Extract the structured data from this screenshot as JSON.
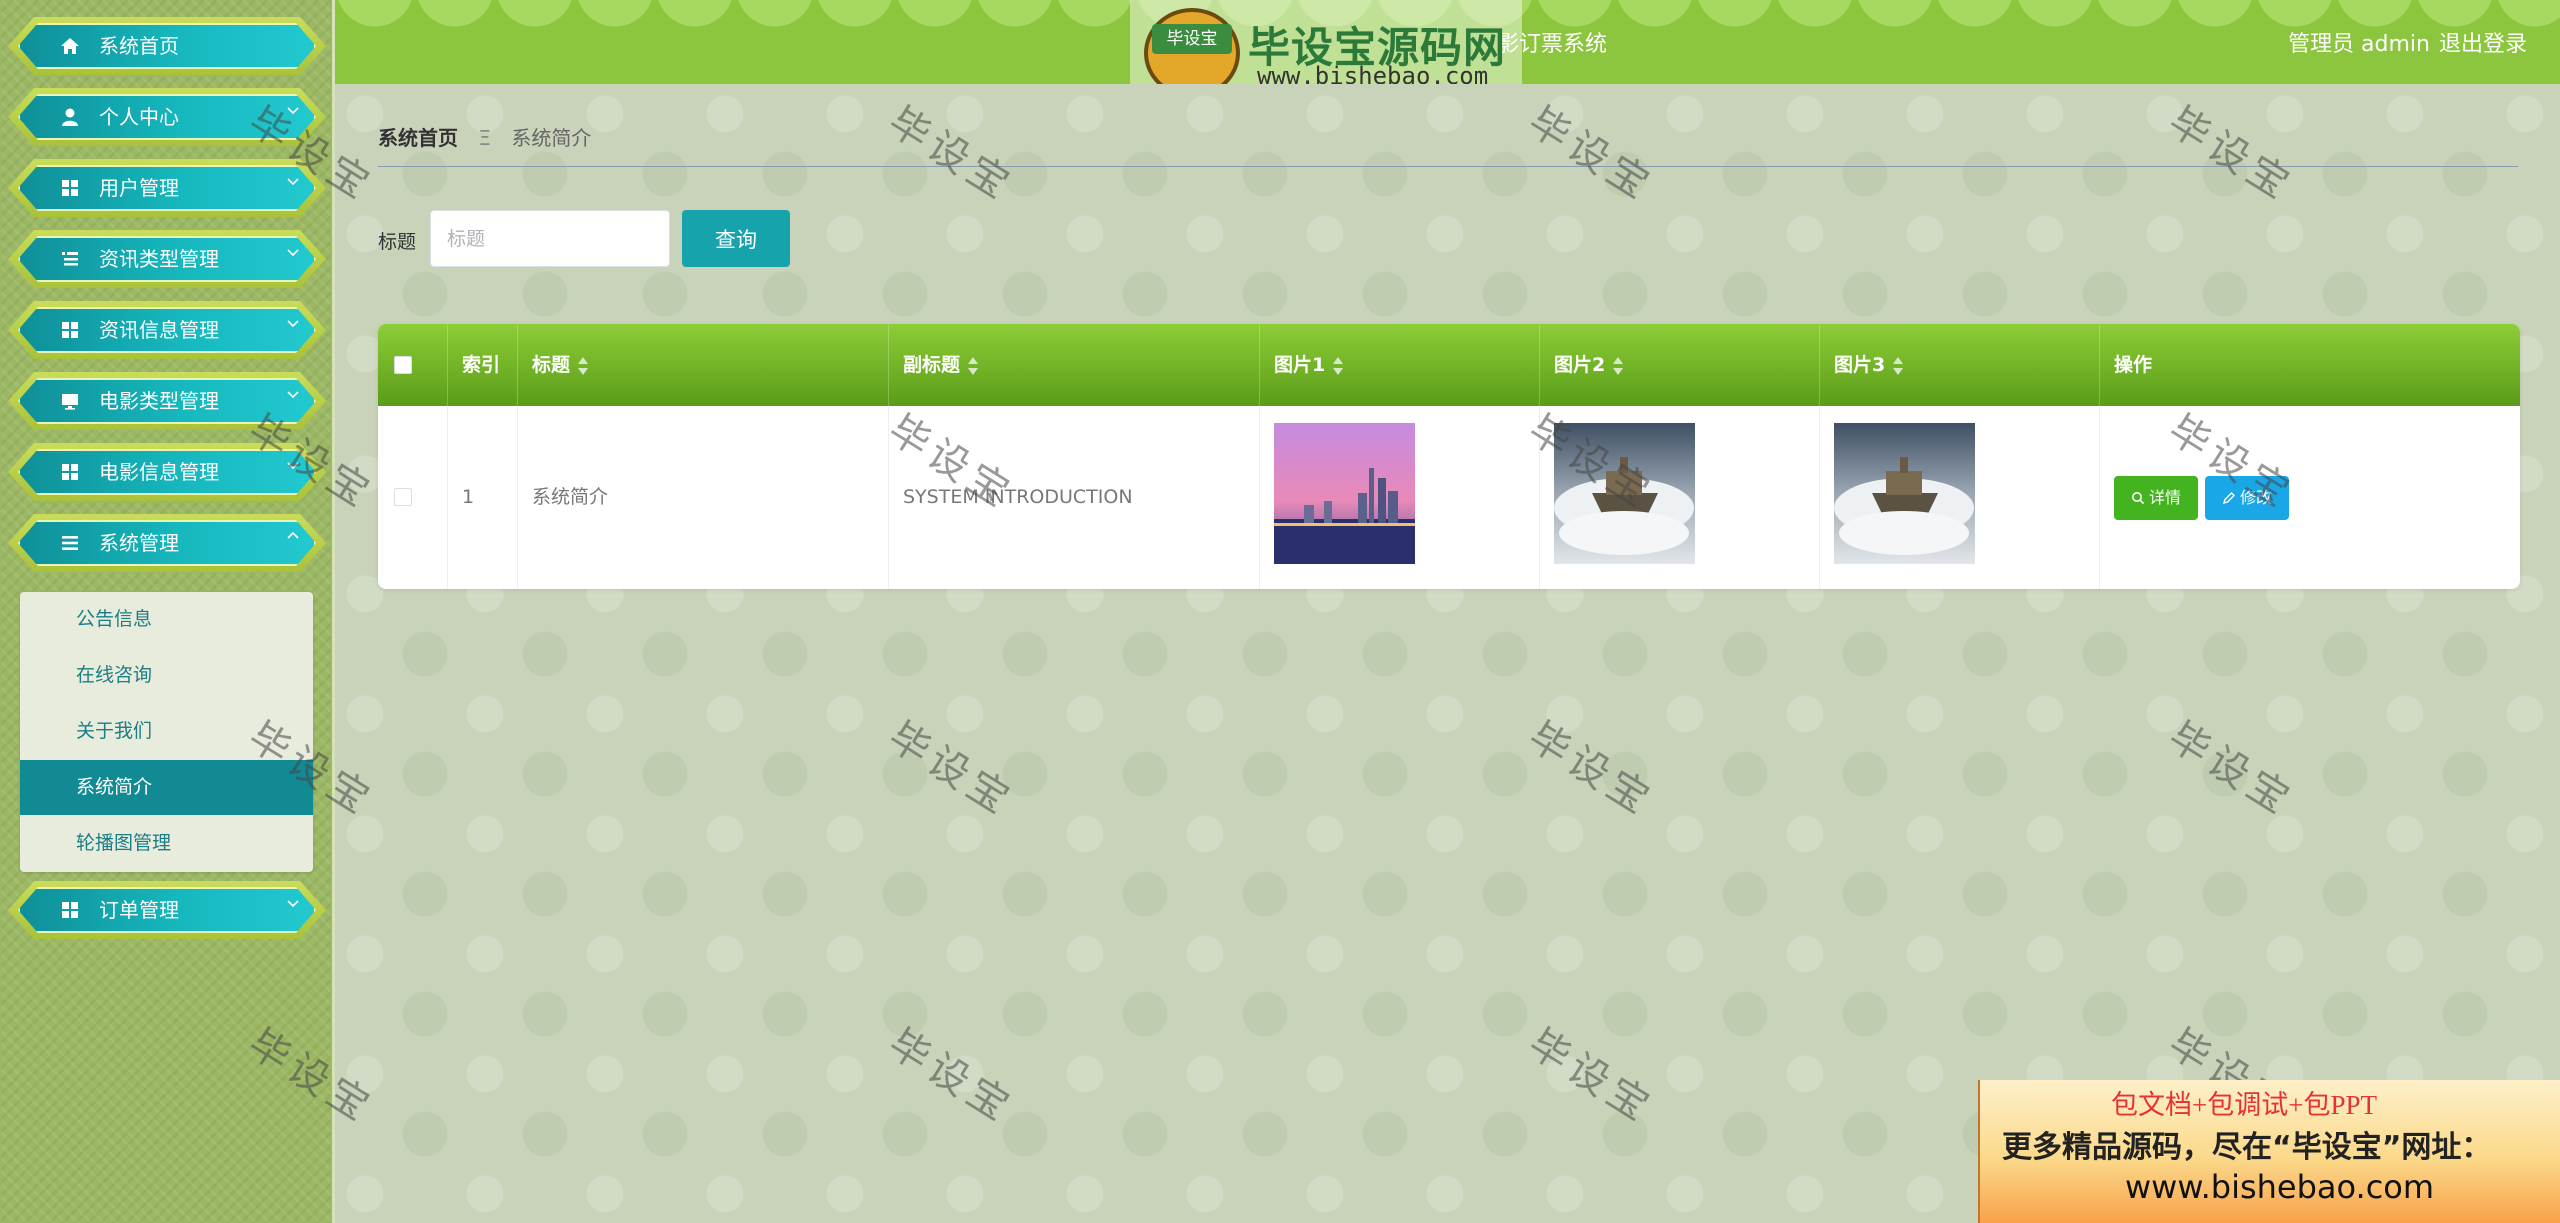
{
  "header": {
    "title_suffix": "影订票系统",
    "user": "管理员 admin",
    "logout": "退出登录"
  },
  "logo_watermark": {
    "badge": "毕设宝",
    "name": "毕设宝源码网",
    "url": "www.bishebao.com"
  },
  "sidebar": {
    "items": [
      {
        "label": "系统首页",
        "icon": "home-icon"
      },
      {
        "label": "个人中心",
        "icon": "user-icon"
      },
      {
        "label": "用户管理",
        "icon": "grid-icon"
      },
      {
        "label": "资讯类型管理",
        "icon": "list-icon"
      },
      {
        "label": "资讯信息管理",
        "icon": "grid-icon"
      },
      {
        "label": "电影类型管理",
        "icon": "monitor-icon"
      },
      {
        "label": "电影信息管理",
        "icon": "grid-icon"
      },
      {
        "label": "系统管理",
        "icon": "menu-icon"
      },
      {
        "label": "订单管理",
        "icon": "grid-icon"
      }
    ],
    "submenu": [
      {
        "label": "公告信息"
      },
      {
        "label": "在线咨询"
      },
      {
        "label": "关于我们"
      },
      {
        "label": "系统简介",
        "active": true
      },
      {
        "label": "轮播图管理"
      }
    ]
  },
  "breadcrumb": {
    "home": "系统首页",
    "separator": "Ξ",
    "current": "系统简介"
  },
  "search": {
    "label": "标题",
    "placeholder": "标题",
    "button": "查询"
  },
  "table": {
    "headers": [
      "索引",
      "标题",
      "副标题",
      "图片1",
      "图片2",
      "图片3",
      "操作"
    ],
    "rows": [
      {
        "index": "1",
        "title": "系统简介",
        "subtitle": "SYSTEM INTRODUCTION",
        "actions": [
          "详情",
          "修改"
        ]
      }
    ]
  },
  "watermark_text": "毕设宝",
  "promo": {
    "line1": "包文档+包调试+包PPT",
    "line2": "更多精品源码，尽在“毕设宝”网址：",
    "line3": "www.bishebao.com"
  },
  "colors": {
    "header": "#8cc63f",
    "menu_teal": "#16b8be",
    "query_button": "#16a3ac",
    "detail_button": "#43b41f",
    "edit_button": "#1aa7e8"
  }
}
